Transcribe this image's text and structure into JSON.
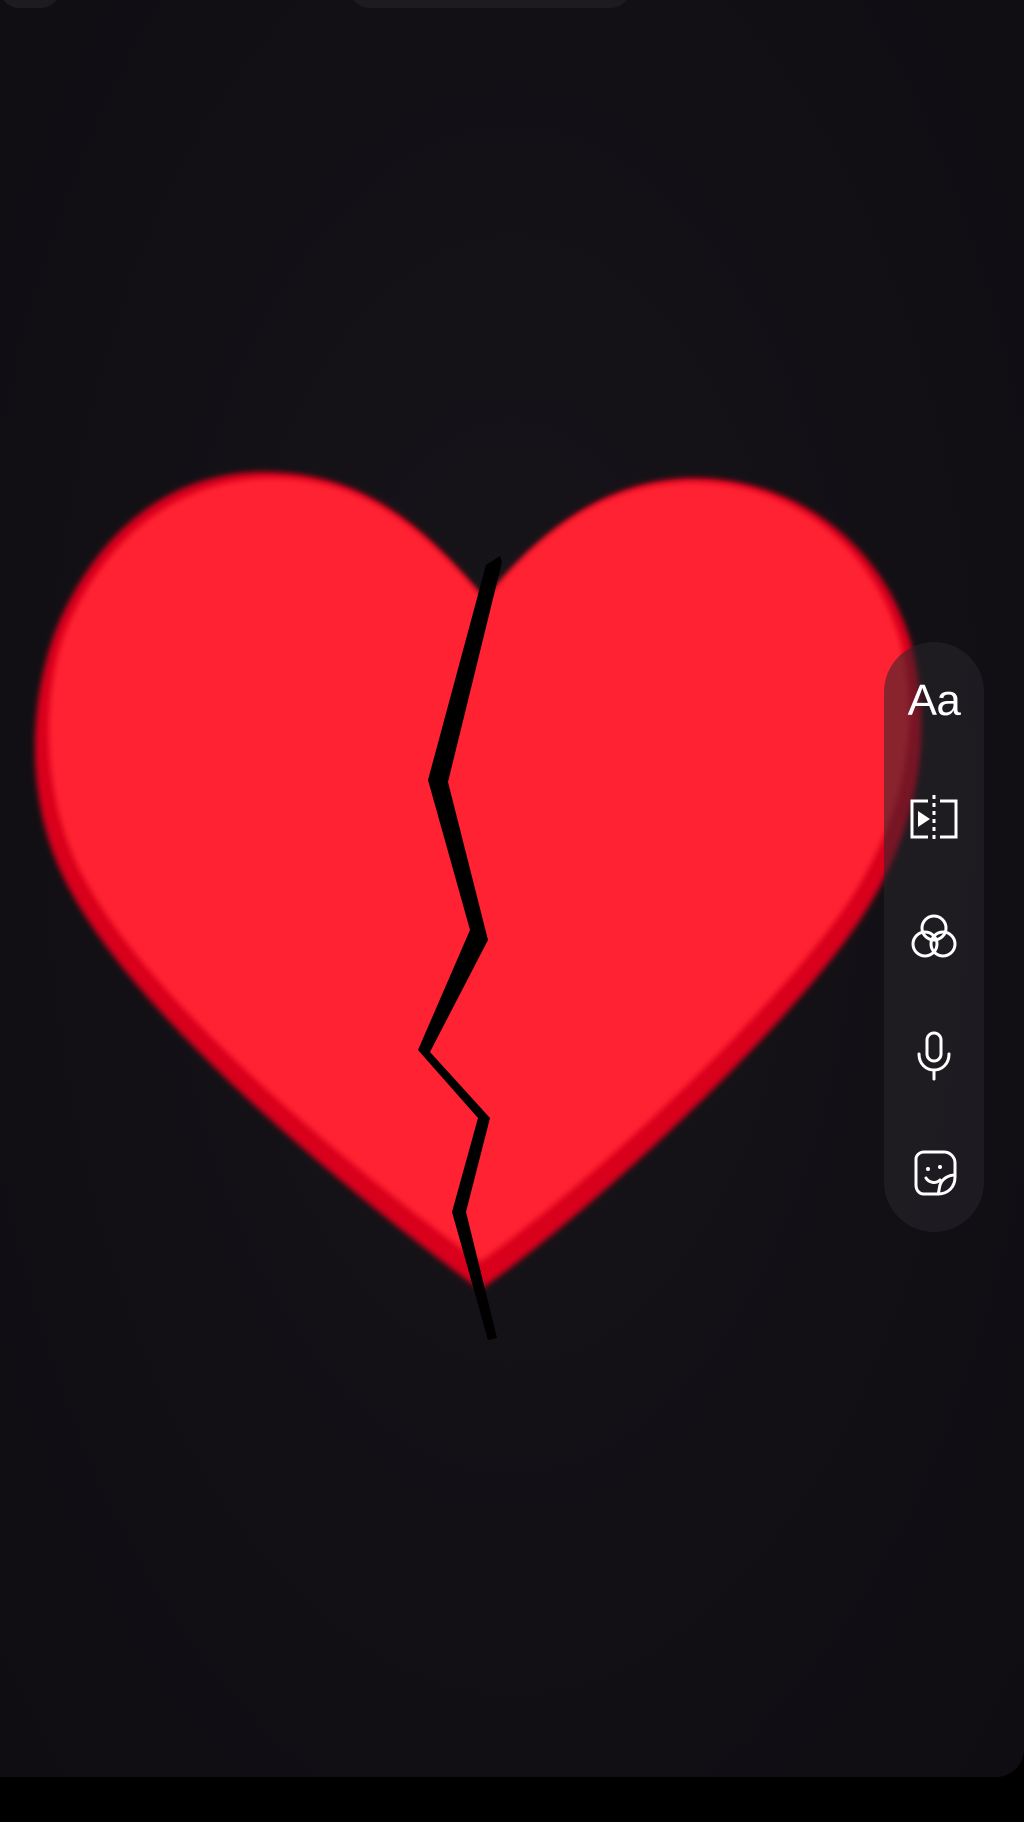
{
  "screen": {
    "background": "#121015",
    "bottom_bar_color": "#000000"
  },
  "artwork": {
    "subject": "broken-heart",
    "heart_color": "#ff2030",
    "heart_shadow_color": "#d9001f",
    "crack_color": "#000000"
  },
  "toolbar": {
    "text_tool_label": "Aa",
    "tools": [
      {
        "id": "text",
        "icon": "text-icon"
      },
      {
        "id": "trim",
        "icon": "clip-trim-icon"
      },
      {
        "id": "filters",
        "icon": "filters-icon"
      },
      {
        "id": "voiceover",
        "icon": "microphone-icon"
      },
      {
        "id": "stickers",
        "icon": "sticker-icon"
      }
    ]
  }
}
